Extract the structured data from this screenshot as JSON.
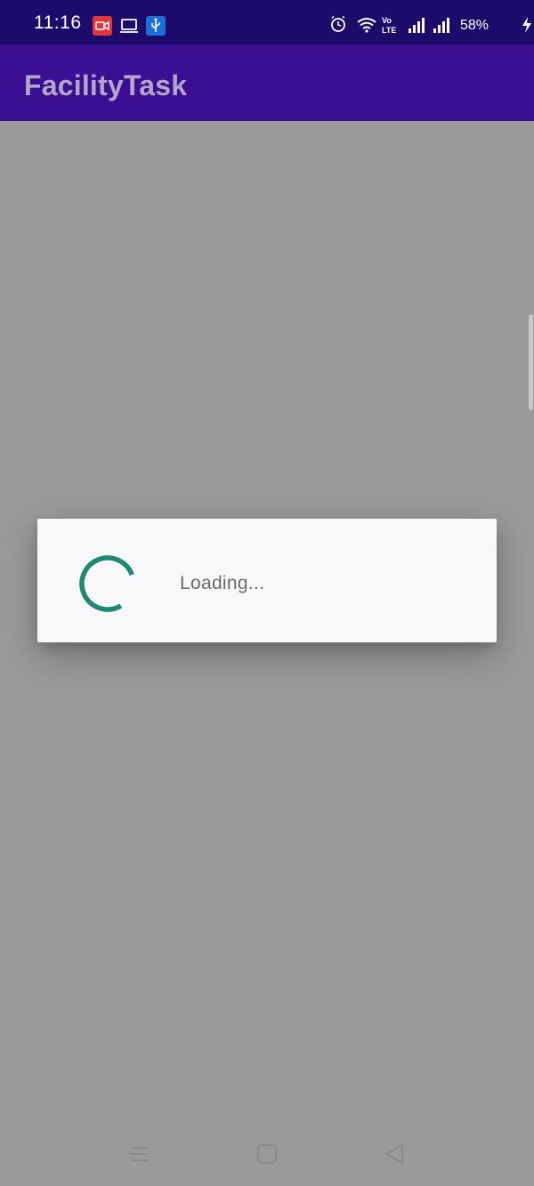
{
  "status_bar": {
    "time": "11:16",
    "battery": "58%",
    "left_icons": [
      "screen-record-icon",
      "laptop-icon",
      "usb-icon"
    ],
    "right_icons": [
      "alarm-icon",
      "wifi-icon",
      "volte-icon",
      "signal-icon",
      "signal-icon-2",
      "charging-icon"
    ],
    "volte_label": "Vo LTE"
  },
  "app_bar": {
    "title": "FacilityTask",
    "color": "#3b0f91"
  },
  "dialog": {
    "message": "Loading...",
    "spinner_color": "#1f8a72"
  },
  "nav_bar": {
    "buttons": [
      "menu-icon",
      "home-icon",
      "back-icon"
    ]
  },
  "colors": {
    "status_bar": "#1d0b6b",
    "scrim": "#9a999b",
    "dialog_bg": "#f8f7fa"
  }
}
